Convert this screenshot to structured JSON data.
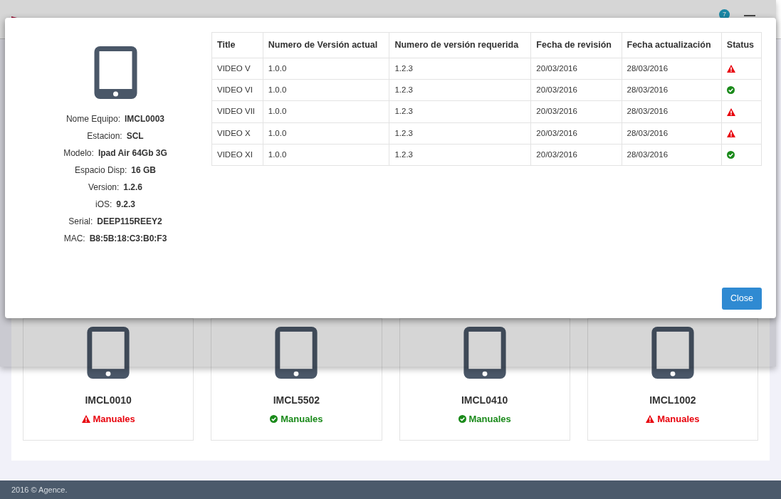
{
  "header": {
    "notification_count": "7"
  },
  "modal": {
    "device_fields": [
      {
        "label": "Nome Equipo:",
        "value": "IMCL0003"
      },
      {
        "label": "Estacion:",
        "value": "SCL"
      },
      {
        "label": "Modelo:",
        "value": "Ipad Air 64Gb 3G"
      },
      {
        "label": "Espacio Disp:",
        "value": "16 GB"
      },
      {
        "label": "Version:",
        "value": "1.2.6"
      },
      {
        "label": "iOS:",
        "value": "9.2.3"
      },
      {
        "label": "Serial:",
        "value": "DEEP115REEY2"
      },
      {
        "label": "MAC:",
        "value": "B8:5B:18:C3:B0:F3"
      }
    ],
    "table": {
      "columns": [
        "Title",
        "Numero de Versión actual",
        "Numero de versión requerida",
        "Fecha de revisión",
        "Fecha actualización",
        "Status"
      ],
      "rows": [
        {
          "title": "VIDEO V",
          "current_version": "1.0.0",
          "required_version": "1.2.3",
          "review_date": "20/03/2016",
          "update_date": "28/03/2016",
          "kind": "warning"
        },
        {
          "title": "VIDEO VI",
          "current_version": "1.0.0",
          "required_version": "1.2.3",
          "review_date": "20/03/2016",
          "update_date": "28/03/2016",
          "kind": "ok"
        },
        {
          "title": "VIDEO VII",
          "current_version": "1.0.0",
          "required_version": "1.2.3",
          "review_date": "20/03/2016",
          "update_date": "28/03/2016",
          "kind": "warning"
        },
        {
          "title": "VIDEO X",
          "current_version": "1.0.0",
          "required_version": "1.2.3",
          "review_date": "20/03/2016",
          "update_date": "28/03/2016",
          "kind": "warning"
        },
        {
          "title": "VIDEO XI",
          "current_version": "1.0.0",
          "required_version": "1.2.3",
          "review_date": "20/03/2016",
          "update_date": "28/03/2016",
          "kind": "ok"
        }
      ]
    },
    "close_button": "Close"
  },
  "devices": [
    {
      "name": "IMCL0010",
      "label": "Manuales",
      "kind": "warning"
    },
    {
      "name": "IMCL5502",
      "label": "Manuales",
      "kind": "ok"
    },
    {
      "name": "IMCL0410",
      "label": "Manuales",
      "kind": "ok"
    },
    {
      "name": "IMCL1002",
      "label": "Manuales",
      "kind": "warning"
    }
  ],
  "footer": "2016 © Agence."
}
